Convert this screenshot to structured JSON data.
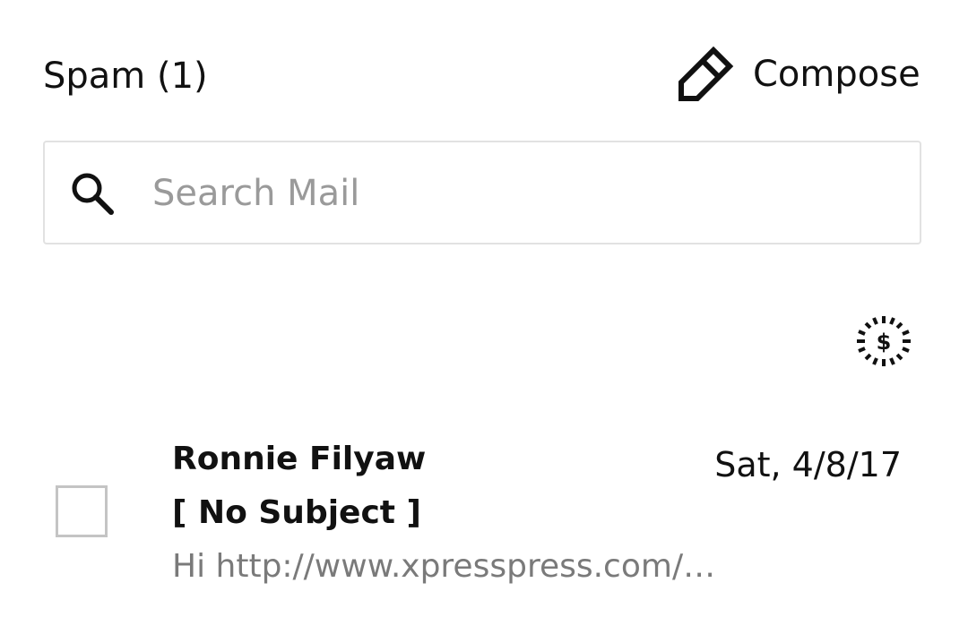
{
  "header": {
    "folder_title": "Spam (1)",
    "compose_label": "Compose",
    "compose_icon": "pencil-icon"
  },
  "search": {
    "placeholder": "Search Mail",
    "value": "",
    "icon": "search-icon"
  },
  "toolbar": {
    "offers_icon": "dollar-burst-icon"
  },
  "messages": [
    {
      "sender": "Ronnie Filyaw",
      "date": "Sat, 4/8/17",
      "subject": "[ No Subject ]",
      "snippet": "Hi http://www.xpresspress.com/…",
      "checked": false
    }
  ],
  "colors": {
    "text": "#111111",
    "placeholder": "#9a9a9a",
    "snippet": "#7a7a7a",
    "border": "#e2e2e2",
    "checkbox_border": "#c4c4c4"
  }
}
